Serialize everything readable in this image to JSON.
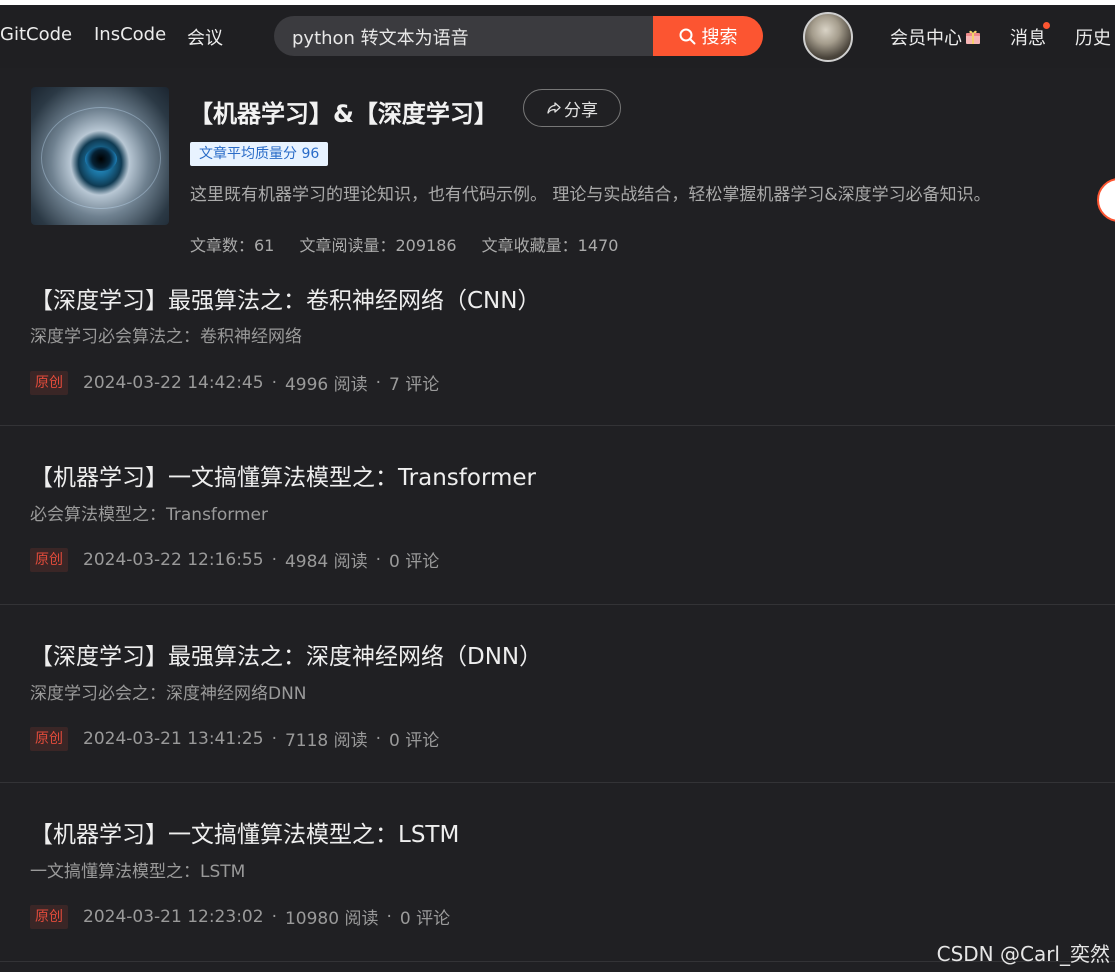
{
  "header": {
    "nav": [
      "GitCode",
      "InsCode",
      "会议"
    ],
    "search_value": "python 转文本为语音",
    "search_button": "搜索",
    "vip_label": "会员中心",
    "messages_label": "消息",
    "history_label": "历史"
  },
  "column": {
    "title": "【机器学习】&【深度学习】",
    "share_label": "分享",
    "quality_badge": "文章平均质量分 96",
    "description": "这里既有机器学习的理论知识，也有代码示例。 理论与实战结合，轻松掌握机器学习&深度学习必备知识。",
    "stats": {
      "articles": "文章数：61",
      "reads": "文章阅读量：209186",
      "favorites": "文章收藏量：1470"
    }
  },
  "articles": [
    {
      "title": "【深度学习】最强算法之：卷积神经网络（CNN）",
      "description": "深度学习必会算法之：卷积神经网络",
      "tag": "原创",
      "date": "2024-03-22 14:42:45",
      "reads": "4996 阅读",
      "comments": "7 评论"
    },
    {
      "title": "【机器学习】一文搞懂算法模型之：Transformer",
      "description": "必会算法模型之：Transformer",
      "tag": "原创",
      "date": "2024-03-22 12:16:55",
      "reads": "4984 阅读",
      "comments": "0 评论"
    },
    {
      "title": "【深度学习】最强算法之：深度神经网络（DNN）",
      "description": "深度学习必会之：深度神经网络DNN",
      "tag": "原创",
      "date": "2024-03-21 13:41:25",
      "reads": "7118 阅读",
      "comments": "0 评论"
    },
    {
      "title": "【机器学习】一文搞懂算法模型之：LSTM",
      "description": "一文搞懂算法模型之：LSTM",
      "tag": "原创",
      "date": "2024-03-21 12:23:02",
      "reads": "10980 阅读",
      "comments": "0 评论"
    }
  ],
  "watermark": "CSDN @Carl_奕然",
  "colors": {
    "background": "#202023",
    "accent": "#fc5531",
    "badge_text": "#2a6cc8",
    "original_tag": "#e14b3b"
  }
}
